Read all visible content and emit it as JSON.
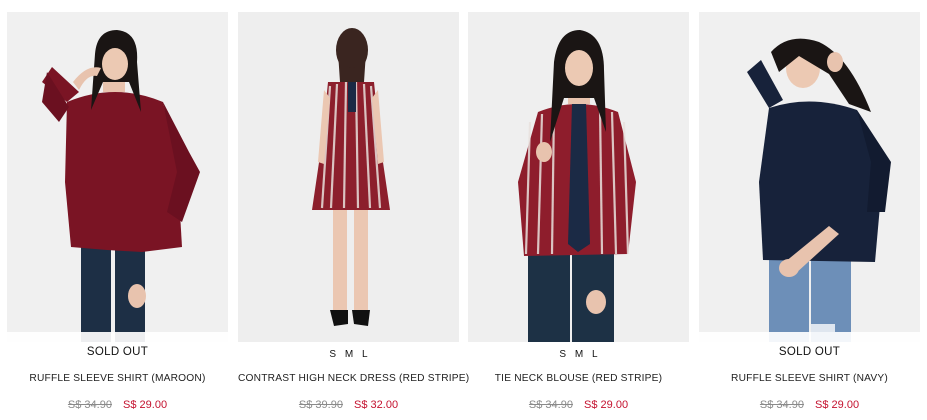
{
  "products": [
    {
      "name": "RUFFLE SLEEVE SHIRT (MAROON)",
      "status": "SOLD OUT",
      "sizes": [],
      "old_price": "S$ 34.90",
      "new_price": "S$ 29.00",
      "colors": {
        "garment": "#7a1424",
        "pants": "#1d2f45",
        "bg": "#f0f0f0"
      }
    },
    {
      "name": "CONTRAST HIGH NECK DRESS (RED STRIPE)",
      "status": "",
      "sizes": [
        "S",
        "M",
        "L"
      ],
      "old_price": "S$ 39.90",
      "new_price": "S$ 32.00",
      "colors": {
        "garment": "#8c1f2c",
        "stripe": "#e8e0dc",
        "bg": "#eeeeee"
      }
    },
    {
      "name": "TIE NECK BLOUSE (RED STRIPE)",
      "status": "",
      "sizes": [
        "S",
        "M",
        "L"
      ],
      "old_price": "S$ 34.90",
      "new_price": "S$ 29.00",
      "colors": {
        "garment": "#8e1d2c",
        "stripe": "#e9e2de",
        "tie": "#1b2a45",
        "pants": "#1d3145",
        "bg": "#efefef"
      }
    },
    {
      "name": "RUFFLE SLEEVE SHIRT (NAVY)",
      "status": "SOLD OUT",
      "sizes": [],
      "old_price": "S$ 34.90",
      "new_price": "S$ 29.00",
      "colors": {
        "garment": "#17223a",
        "jeans": "#6d8fb8",
        "bg": "#f0f0f0"
      }
    }
  ]
}
